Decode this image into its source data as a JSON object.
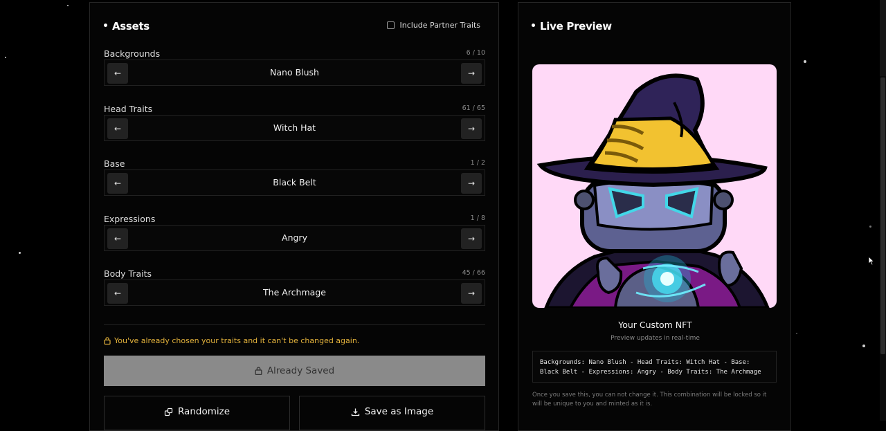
{
  "assets": {
    "title": "Assets",
    "partner_label": "Include Partner Traits",
    "partner_checked": false,
    "traits": [
      {
        "label": "Backgrounds",
        "count": "6 / 10",
        "value": "Nano Blush"
      },
      {
        "label": "Head Traits",
        "count": "61 / 65",
        "value": "Witch Hat"
      },
      {
        "label": "Base",
        "count": "1 / 2",
        "value": "Black Belt"
      },
      {
        "label": "Expressions",
        "count": "1 / 8",
        "value": "Angry"
      },
      {
        "label": "Body Traits",
        "count": "45 / 66",
        "value": "The Archmage"
      }
    ],
    "prev_arrow": "←",
    "next_arrow": "→",
    "warning": "You've already chosen your traits and it can't be changed again.",
    "saved_label": "Already Saved",
    "randomize_label": "Randomize",
    "save_image_label": "Save as Image"
  },
  "preview": {
    "title": "Live Preview",
    "nft_title": "Your Custom NFT",
    "nft_subtitle": "Preview updates in real-time",
    "traits_summary": "Backgrounds: Nano Blush - Head Traits: Witch Hat - Base: Black Belt - Expressions: Angry - Body Traits: The Archmage",
    "note": "Once you save this, you can not change it. This combination will be locked so it will be unique to you and minted as it is."
  },
  "colors": {
    "background": "#000000",
    "panel": "#050505",
    "warning": "#e3b23c",
    "nft_background": "#ffd9f7",
    "saved_button": "#8a8a8a"
  },
  "icons": [
    "arrow-left-icon",
    "arrow-right-icon",
    "lock-icon",
    "shuffle-icon",
    "download-icon",
    "checkbox-icon",
    "cursor-icon"
  ]
}
